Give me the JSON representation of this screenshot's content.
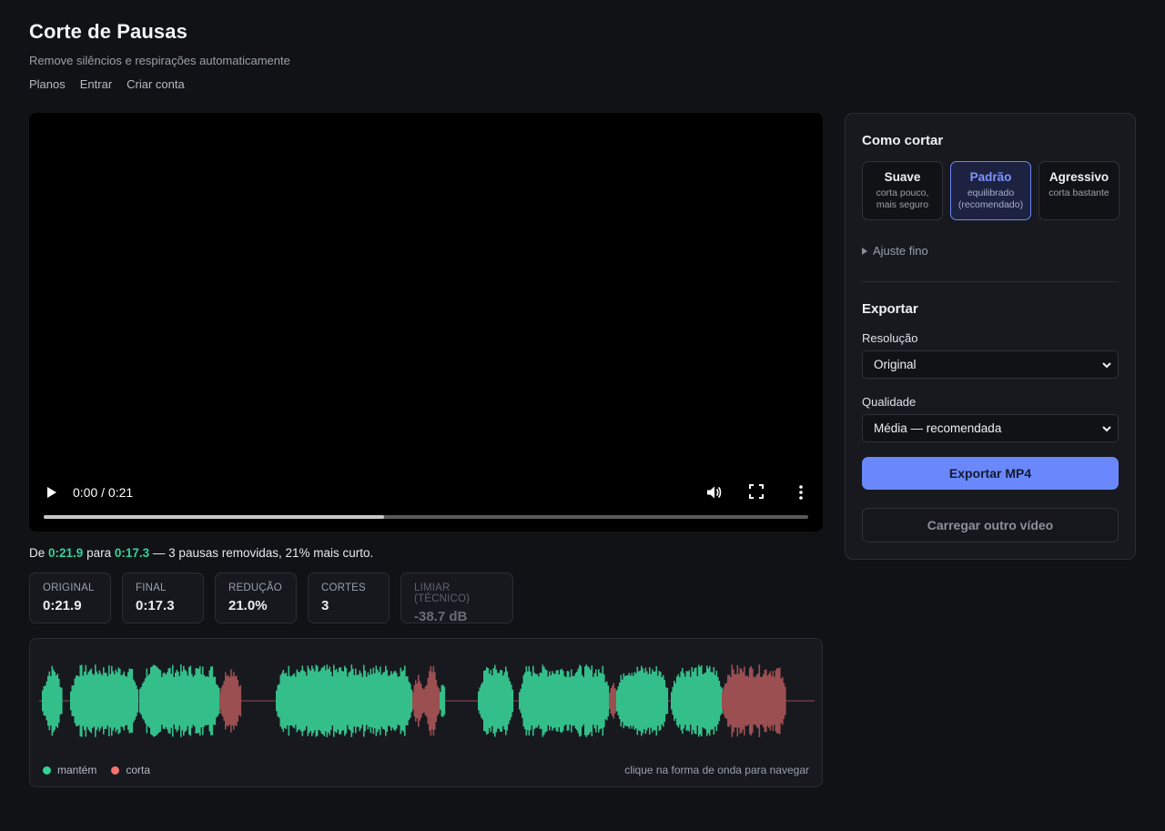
{
  "header": {
    "title": "Corte de Pausas",
    "subtitle": "Remove silêncios e respirações automaticamente",
    "nav": [
      "Planos",
      "Entrar",
      "Criar conta"
    ]
  },
  "player": {
    "time": "0:00 / 0:21",
    "buffered_fraction": 0.445
  },
  "summary": {
    "prefix": "De",
    "from": "0:21.9",
    "mid": "para",
    "to": "0:17.3",
    "suffix": "— 3 pausas removidas, 21% mais curto."
  },
  "stats": [
    {
      "label": "ORIGINAL",
      "value": "0:21.9"
    },
    {
      "label": "FINAL",
      "value": "0:17.3"
    },
    {
      "label": "REDUÇÃO",
      "value": "21.0%"
    },
    {
      "label": "CORTES",
      "value": "3"
    },
    {
      "label": "LIMIAR (TÉCNICO)",
      "value": "-38.7 dB"
    }
  ],
  "waveform": {
    "legend_keep": "mantém",
    "legend_cut": "corta",
    "hint": "clique na forma de onda para navegar",
    "colors": {
      "keep": "#34bf8a",
      "cut": "#9b4f50",
      "line": "#6b3a3b"
    }
  },
  "panel": {
    "cut_title": "Como cortar",
    "modes": [
      {
        "name": "Suave",
        "desc": "corta pouco, mais seguro",
        "active": false
      },
      {
        "name": "Padrão",
        "desc": "equilibrado (recomendado)",
        "active": true
      },
      {
        "name": "Agressivo",
        "desc": "corta bastante",
        "active": false
      }
    ],
    "fine_tune": "Ajuste fino",
    "export_title": "Exportar",
    "resolution_label": "Resolução",
    "resolution_value": "Original",
    "quality_label": "Qualidade",
    "quality_value": "Média — recomendada",
    "export_button": "Exportar MP4",
    "reload_button": "Carregar outro vídeo"
  },
  "colors": {
    "accent": "#6a88fb",
    "keep": "#34d399",
    "cut": "#f87171"
  }
}
